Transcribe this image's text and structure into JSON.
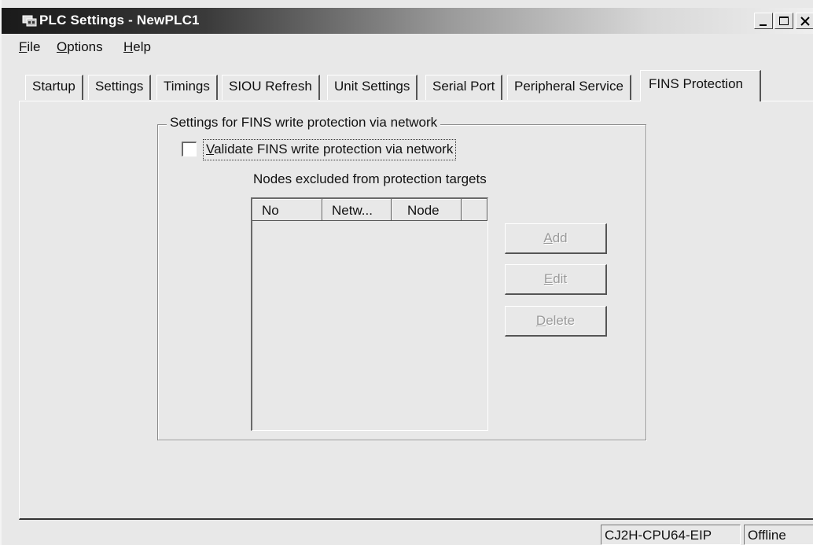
{
  "window": {
    "title": "PLC Settings - NewPLC1",
    "controls": [
      "minimize",
      "maximize",
      "close"
    ]
  },
  "menu": [
    {
      "label": "File",
      "accel": "F",
      "rest": "ile"
    },
    {
      "label": "Options",
      "accel": "O",
      "rest": "ptions"
    },
    {
      "label": "Help",
      "accel": "H",
      "rest": "elp"
    }
  ],
  "tabs": [
    {
      "label": "Startup",
      "active": false
    },
    {
      "label": "Settings",
      "active": false
    },
    {
      "label": "Timings",
      "active": false
    },
    {
      "label": "SIOU Refresh",
      "active": false
    },
    {
      "label": "Unit Settings",
      "active": false
    },
    {
      "label": "Serial Port",
      "active": false
    },
    {
      "label": "Peripheral Service",
      "active": false
    },
    {
      "label": "FINS Protection",
      "active": true
    }
  ],
  "fins_group": {
    "legend": "Settings for FINS write protection via network",
    "checkbox": {
      "accel": "V",
      "rest": "alidate FINS write protection via network",
      "checked": false
    },
    "list_caption": "Nodes excluded from protection targets",
    "columns": [
      "No",
      "Netw...",
      "Node"
    ],
    "rows": [],
    "buttons": [
      {
        "accel": "A",
        "rest": "dd",
        "enabled": false
      },
      {
        "accel": "E",
        "rest": "dit",
        "enabled": false
      },
      {
        "accel": "D",
        "rest": "elete",
        "enabled": false
      }
    ]
  },
  "status": {
    "model": "CJ2H-CPU64-EIP",
    "connection": "Offline"
  }
}
